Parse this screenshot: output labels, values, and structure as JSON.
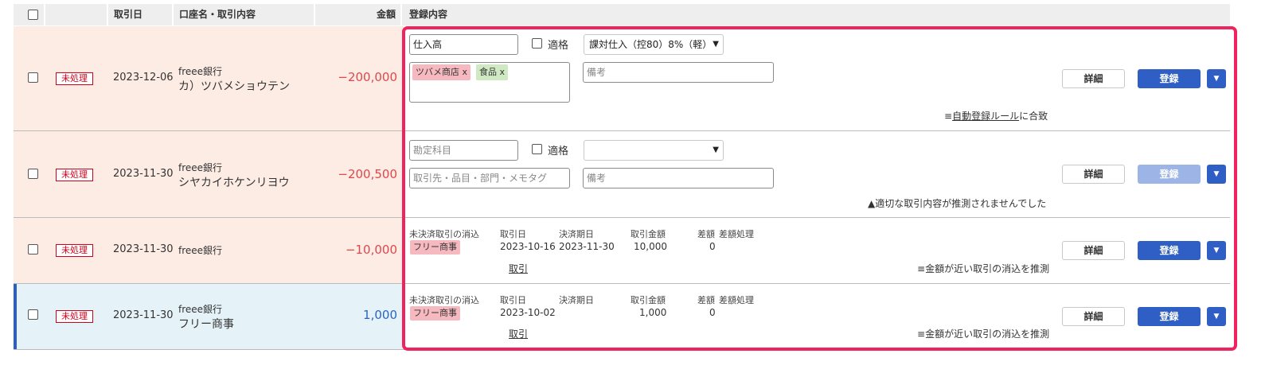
{
  "header": {
    "date": "取引日",
    "account": "口座名・取引内容",
    "amount": "金額",
    "registration": "登録内容"
  },
  "rows": [
    {
      "status": "未処理",
      "date": "2023-12-06",
      "bank": "freee銀行",
      "description": "カ）ツバメショウテン",
      "amount": "−200,000",
      "account_item": "仕入高",
      "qualified_label": "適格",
      "tax": "課対仕入（控80）8%（軽）",
      "tags": [
        "ツバメ商店 x",
        "食品 x"
      ],
      "memo_placeholder": "備考",
      "note_icon": "≡",
      "note_link": "自動登録ルール",
      "note_text": "に合致"
    },
    {
      "status": "未処理",
      "date": "2023-11-30",
      "bank": "freee銀行",
      "description": "シヤカイホケンリヨウ",
      "amount": "−200,500",
      "account_item_placeholder": "勘定科目",
      "qualified_label": "適格",
      "tax": "",
      "tags_placeholder": "取引先・品目・部門・メモタグ",
      "memo_placeholder": "備考",
      "note_icon": "▲",
      "note_text": "適切な取引内容が推測されませんでした"
    },
    {
      "status": "未処理",
      "date": "2023-11-30",
      "bank": "freee銀行",
      "description": "",
      "amount": "−10,000",
      "recon_title": "未決済取引の消込",
      "recon_tag": "フリー商事",
      "col_trade_date": "取引日",
      "col_due_date": "決済期日",
      "col_trade_amount": "取引金額",
      "col_diff": "差額",
      "col_diff_proc": "差額処理",
      "trade_date": "2023-10-16",
      "due_date": "2023-11-30",
      "trade_amount": "10,000",
      "diff": "0",
      "trade_link": "取引",
      "note_icon": "≡",
      "note_text": "金額が近い取引の消込を推測"
    },
    {
      "status": "未処理",
      "date": "2023-11-30",
      "bank": "freee銀行",
      "description": "フリー商事",
      "amount": "1,000",
      "recon_title": "未決済取引の消込",
      "recon_tag": "フリー商事",
      "col_trade_date": "取引日",
      "col_due_date": "決済期日",
      "col_trade_amount": "取引金額",
      "col_diff": "差額",
      "col_diff_proc": "差額処理",
      "trade_date": "2023-10-02",
      "due_date": "",
      "trade_amount": "1,000",
      "diff": "0",
      "trade_link": "取引",
      "note_icon": "≡",
      "note_text": "金額が近い取引の消込を推測"
    }
  ],
  "buttons": {
    "detail": "詳細",
    "register": "登録",
    "dropdown_icon": "▼"
  },
  "colors": {
    "unprocessed_bg": "#fdece4",
    "selected_bg": "#e5f2f8",
    "selected_bar": "#2b5fc4",
    "highlight_border": "#f0235e",
    "negative_amount": "#e0474c",
    "positive_amount": "#2b65c2"
  }
}
